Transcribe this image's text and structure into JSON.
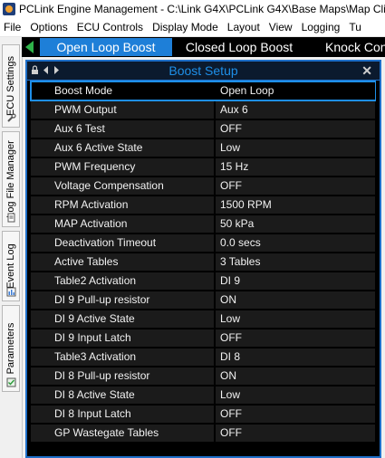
{
  "window": {
    "title": "PCLink Engine Management - C:\\Link G4X\\PCLink G4X\\Base Maps\\Map Clie"
  },
  "menu": [
    "File",
    "Options",
    "ECU Controls",
    "Display Mode",
    "Layout",
    "View",
    "Logging",
    "Tu"
  ],
  "side_tabs": [
    "ECU Settings",
    "Log File Manager",
    "Event Log",
    "Parameters"
  ],
  "tabs": [
    "Open Loop Boost",
    "Closed Loop Boost",
    "Knock Control"
  ],
  "panel": {
    "title": "Boost Setup"
  },
  "rows": [
    {
      "name": "Boost Mode",
      "value": "Open Loop"
    },
    {
      "name": "PWM Output",
      "value": "Aux 6"
    },
    {
      "name": "Aux 6 Test",
      "value": "OFF"
    },
    {
      "name": "Aux 6 Active State",
      "value": "Low"
    },
    {
      "name": "PWM Frequency",
      "value": "15 Hz"
    },
    {
      "name": "Voltage Compensation",
      "value": "OFF"
    },
    {
      "name": "RPM Activation",
      "value": "1500 RPM"
    },
    {
      "name": "MAP Activation",
      "value": "50 kPa"
    },
    {
      "name": "Deactivation Timeout",
      "value": "0.0 secs"
    },
    {
      "name": "Active Tables",
      "value": "3 Tables"
    },
    {
      "name": "Table2  Activation",
      "value": "DI 9"
    },
    {
      "name": "DI 9 Pull-up resistor",
      "value": "ON"
    },
    {
      "name": "DI 9 Active State",
      "value": "Low"
    },
    {
      "name": "DI 9 Input Latch",
      "value": "OFF"
    },
    {
      "name": "Table3  Activation",
      "value": "DI 8"
    },
    {
      "name": "DI 8 Pull-up resistor",
      "value": "ON"
    },
    {
      "name": "DI 8 Active State",
      "value": "Low"
    },
    {
      "name": "DI 8 Input Latch",
      "value": "OFF"
    },
    {
      "name": "GP Wastegate Tables",
      "value": "OFF"
    }
  ],
  "colors": {
    "accent": "#1e7fd8",
    "panel_bg": "#000000",
    "row_bg": "#1b1b1b",
    "title_text": "#1e8fe8"
  }
}
